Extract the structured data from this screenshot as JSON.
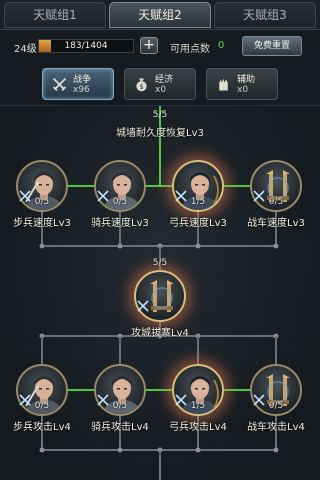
{
  "tabs": [
    {
      "label": "天赋组1",
      "active": false
    },
    {
      "label": "天赋组2",
      "active": true
    },
    {
      "label": "天赋组3",
      "active": false
    }
  ],
  "level": {
    "text": "24级",
    "xp_text": "183/1404",
    "xp_fraction": 0.13
  },
  "points": {
    "label": "可用点数",
    "value": "0"
  },
  "reset_label": "免费重置",
  "categories": [
    {
      "name": "战争",
      "count": "x96",
      "icon": "crossed-swords-icon",
      "active": true
    },
    {
      "name": "经济",
      "count": "x0",
      "icon": "money-pouch-icon",
      "active": false
    },
    {
      "name": "辅助",
      "count": "x0",
      "icon": "gauntlet-icon",
      "active": false
    }
  ],
  "top_node": {
    "count": "5/5",
    "label": "城墙耐久度恢复Lv3"
  },
  "row1": [
    {
      "label": "步兵速度Lv3",
      "count": "0/5",
      "icon": "infantry-icon",
      "lit": false
    },
    {
      "label": "骑兵速度Lv3",
      "count": "0/5",
      "icon": "cavalry-icon",
      "lit": false
    },
    {
      "label": "弓兵速度Lv3",
      "count": "1/5",
      "icon": "archer-icon",
      "lit": true
    },
    {
      "label": "战车速度Lv3",
      "count": "0/5",
      "icon": "chariot-icon",
      "lit": false
    }
  ],
  "middle_node": {
    "label": "攻城拔寨Lv4",
    "count": "5/5",
    "icon": "siege-icon"
  },
  "row2": [
    {
      "label": "步兵攻击Lv4",
      "count": "0/5",
      "icon": "infantry-icon",
      "lit": false
    },
    {
      "label": "骑兵攻击Lv4",
      "count": "0/5",
      "icon": "cavalry-icon",
      "lit": false
    },
    {
      "label": "弓兵攻击Lv4",
      "count": "1/5",
      "icon": "archer-icon",
      "lit": true
    },
    {
      "label": "战车攻击Lv4",
      "count": "0/5",
      "icon": "chariot-icon",
      "lit": false
    }
  ],
  "colors": {
    "active_line": "#4ccb3d",
    "inactive_line": "#6a7076",
    "accent_green": "#59d64a",
    "xp_orange": "#e39a3c"
  }
}
